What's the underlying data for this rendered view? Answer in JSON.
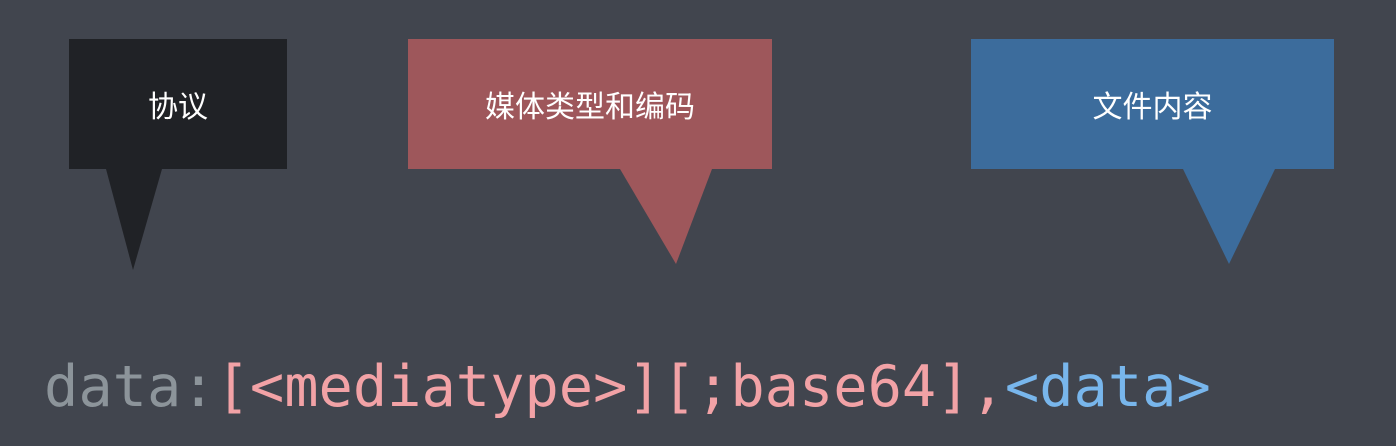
{
  "callouts": {
    "protocol": {
      "label": "协议",
      "color": "#202226"
    },
    "mediatype": {
      "label": "媒体类型和编码",
      "color": "#9e575b"
    },
    "content": {
      "label": "文件内容",
      "color": "#3c6c9c"
    }
  },
  "syntax": {
    "protocol": "data:",
    "mediatype_encoding": "[<mediatype>][;base64],",
    "data": "<data>"
  }
}
